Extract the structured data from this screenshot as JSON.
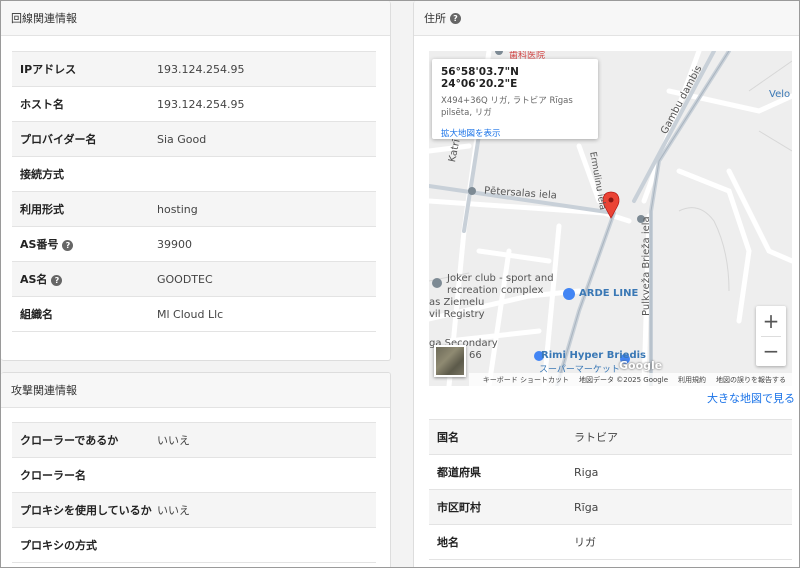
{
  "line_info": {
    "title": "回線関連情報",
    "rows": [
      {
        "key": "IPアドレス",
        "value": "193.124.254.95",
        "help": false
      },
      {
        "key": "ホスト名",
        "value": "193.124.254.95",
        "help": false
      },
      {
        "key": "プロバイダー名",
        "value": "Sia Good",
        "help": false
      },
      {
        "key": "接続方式",
        "value": "",
        "help": false
      },
      {
        "key": "利用形式",
        "value": "hosting",
        "help": false
      },
      {
        "key": "AS番号",
        "value": "39900",
        "help": true
      },
      {
        "key": "AS名",
        "value": "GOODTEC",
        "help": true
      },
      {
        "key": "組織名",
        "value": "Ml Cloud Llc",
        "help": false
      }
    ]
  },
  "attack_info": {
    "title": "攻撃関連情報",
    "rows": [
      {
        "key": "クローラーであるか",
        "value": "いいえ"
      },
      {
        "key": "クローラー名",
        "value": ""
      },
      {
        "key": "プロキシを使用しているか",
        "value": "いいえ"
      },
      {
        "key": "プロキシの方式",
        "value": ""
      }
    ]
  },
  "address": {
    "title": "住所",
    "map": {
      "infobox": {
        "coords": "56°58'03.7\"N 24°06'20.2\"E",
        "address_line1": "X494+36Q リガ, ラトビア Rīgas",
        "address_line2": "pilsēta, リガ",
        "enlarge_link": "拡大地図を表示"
      },
      "labels": {
        "petersalas": "Pētersalas iela",
        "katrinas": "Katrīnas d",
        "gambu": "Gambu dambis",
        "pulkveza": "Pulkveža Brieža iela",
        "vermullu": "Ermulinu iela",
        "joker1": "Joker club - sport and",
        "joker2": "recreation complex",
        "arde": "ARDE LINE",
        "ziemelu1": "as Ziemelu",
        "ziemelu2": "vil Registry",
        "secondary": "ga Secondary",
        "num66": "66",
        "rimi": "Rimi Hyper Briedis",
        "super": "スーパーマーケット",
        "velo": "Velo",
        "dental": "歯科医院"
      },
      "google": "Google",
      "zoom_in": "+",
      "zoom_out": "−",
      "attribution": {
        "shortcuts": "キーボード ショートカット",
        "mapdata": "地図データ ©2025 Google",
        "terms": "利用規約",
        "report": "地図の誤りを報告する"
      }
    },
    "big_map_link": "大きな地図で見る",
    "rows": [
      {
        "key": "国名",
        "value": "ラトビア"
      },
      {
        "key": "都道府県",
        "value": "Riga"
      },
      {
        "key": "市区町村",
        "value": "Rīga"
      },
      {
        "key": "地名",
        "value": "リガ"
      }
    ]
  }
}
